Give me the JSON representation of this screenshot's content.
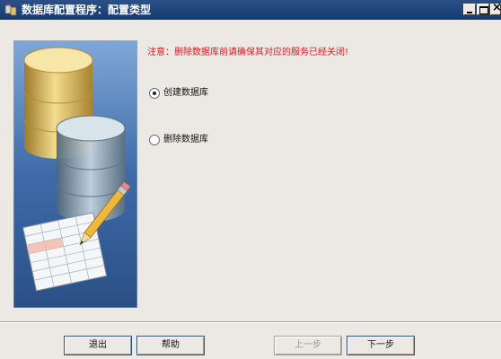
{
  "window": {
    "title": "数据库配置程序：配置类型"
  },
  "content": {
    "warning": "注意：删除数据库前请确保其对应的服务已经关闭!",
    "options": [
      {
        "label": "创建数据库",
        "selected": true
      },
      {
        "label": "删除数据库",
        "selected": false
      }
    ]
  },
  "buttons": {
    "exit": "退出",
    "help": "帮助",
    "prev": "上一步",
    "next": "下一步",
    "prev_enabled": false
  },
  "colors": {
    "titlebar": "#1e447e",
    "warning": "#e8141a",
    "sidebar_bg": "#2f5c96"
  }
}
